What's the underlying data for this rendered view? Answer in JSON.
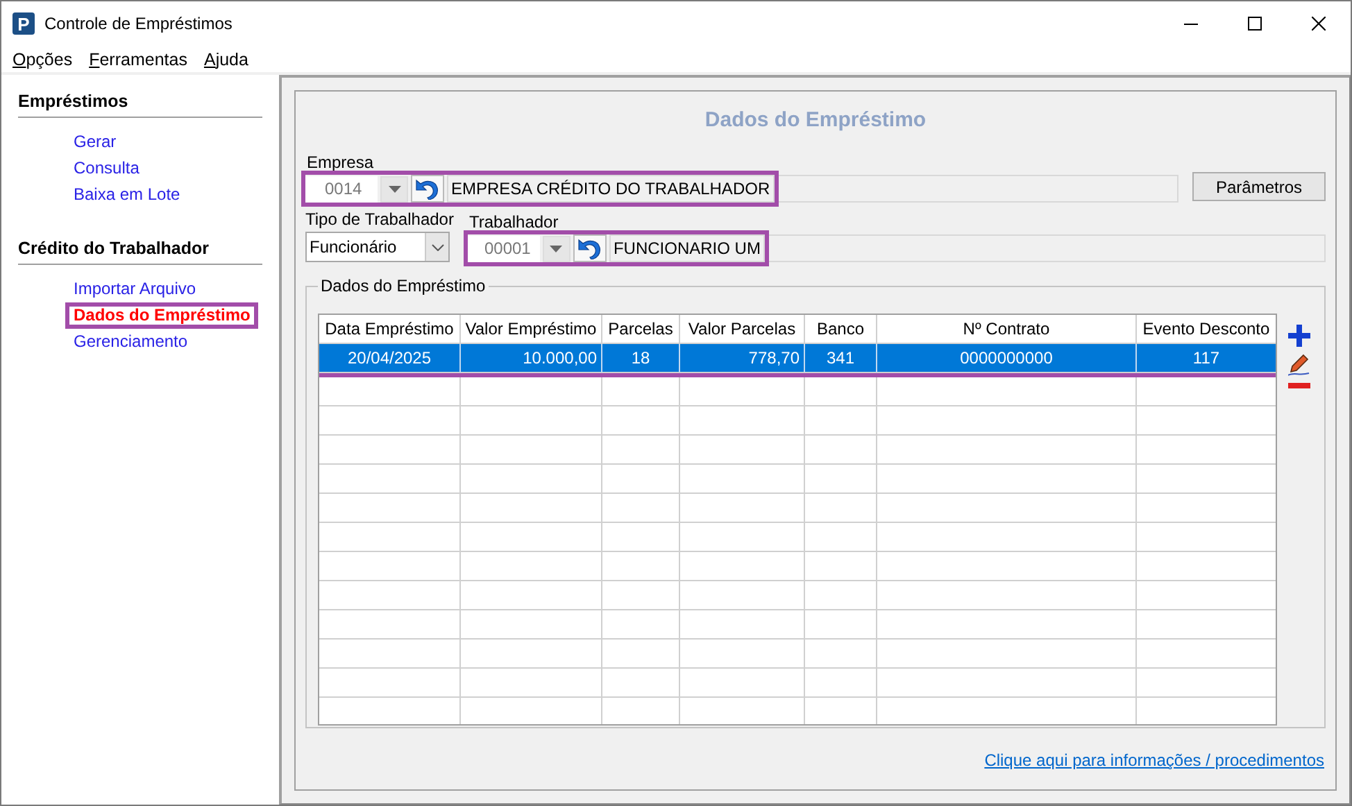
{
  "window": {
    "icon_text": "P",
    "title": "Controle de Empréstimos"
  },
  "menu": [
    {
      "accel": "O",
      "rest": "pções"
    },
    {
      "accel": "F",
      "rest": "erramentas"
    },
    {
      "accel": "A",
      "rest": "juda"
    }
  ],
  "sidebar": {
    "sections": [
      {
        "title": "Empréstimos",
        "items": [
          {
            "label": "Gerar",
            "selected": false,
            "highlighted": false
          },
          {
            "label": "Consulta",
            "selected": false,
            "highlighted": false
          },
          {
            "label": "Baixa em Lote",
            "selected": false,
            "highlighted": false
          }
        ]
      },
      {
        "title": "Crédito do Trabalhador",
        "items": [
          {
            "label": "Importar Arquivo",
            "selected": false,
            "highlighted": false
          },
          {
            "label": "Dados do Empréstimo",
            "selected": true,
            "highlighted": true
          },
          {
            "label": "Gerenciamento",
            "selected": false,
            "highlighted": false
          }
        ]
      }
    ]
  },
  "form": {
    "heading": "Dados do Empréstimo",
    "empresa": {
      "label": "Empresa",
      "code": "0014",
      "name": "EMPRESA CRÉDITO DO TRABALHADOR",
      "highlighted": true
    },
    "parametros_button": "Parâmetros",
    "tipo_trabalhador": {
      "label": "Tipo de Trabalhador",
      "value": "Funcionário"
    },
    "trabalhador": {
      "label": "Trabalhador",
      "code": "00001",
      "name": "FUNCIONARIO UM",
      "highlighted": true
    },
    "group": {
      "title": "Dados do Empréstimo",
      "highlighted": true,
      "columns": [
        "Data Empréstimo",
        "Valor Empréstimo",
        "Parcelas",
        "Valor Parcelas",
        "Banco",
        "Nº Contrato",
        "Evento Desconto"
      ],
      "rows": [
        {
          "cells": [
            "20/04/2025",
            "10.000,00",
            "18",
            "778,70",
            "341",
            "0000000000",
            "117"
          ],
          "selected": true
        }
      ]
    },
    "link": "Clique aqui para informações / procedimentos"
  }
}
